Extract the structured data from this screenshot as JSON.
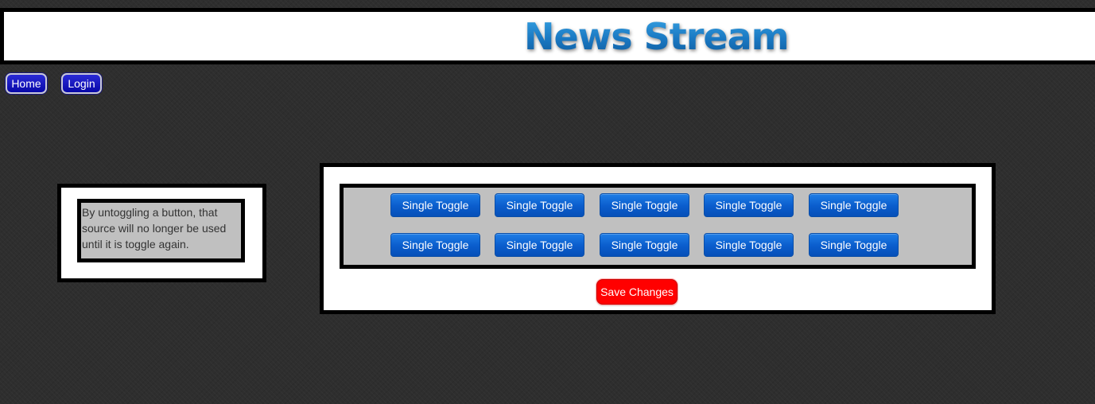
{
  "header": {
    "title": "News Stream"
  },
  "nav": {
    "home_label": "Home",
    "login_label": "Login"
  },
  "info": {
    "text": "By untoggling a button, that source will no longer be used until it is toggle again."
  },
  "toggles": {
    "row1": [
      "Single Toggle",
      "Single Toggle",
      "Single Toggle",
      "Single Toggle",
      "Single Toggle"
    ],
    "row2": [
      "Single Toggle",
      "Single Toggle",
      "Single Toggle",
      "Single Toggle",
      "Single Toggle"
    ]
  },
  "actions": {
    "save_label": "Save Changes"
  },
  "colors": {
    "background": "#2e2e2e",
    "title_blue": "#1c7fc8",
    "nav_button": "#0808a8",
    "toggle_button": "#0a5ccc",
    "save_button": "#ff0000",
    "panel_gray": "#c0c0c0"
  }
}
